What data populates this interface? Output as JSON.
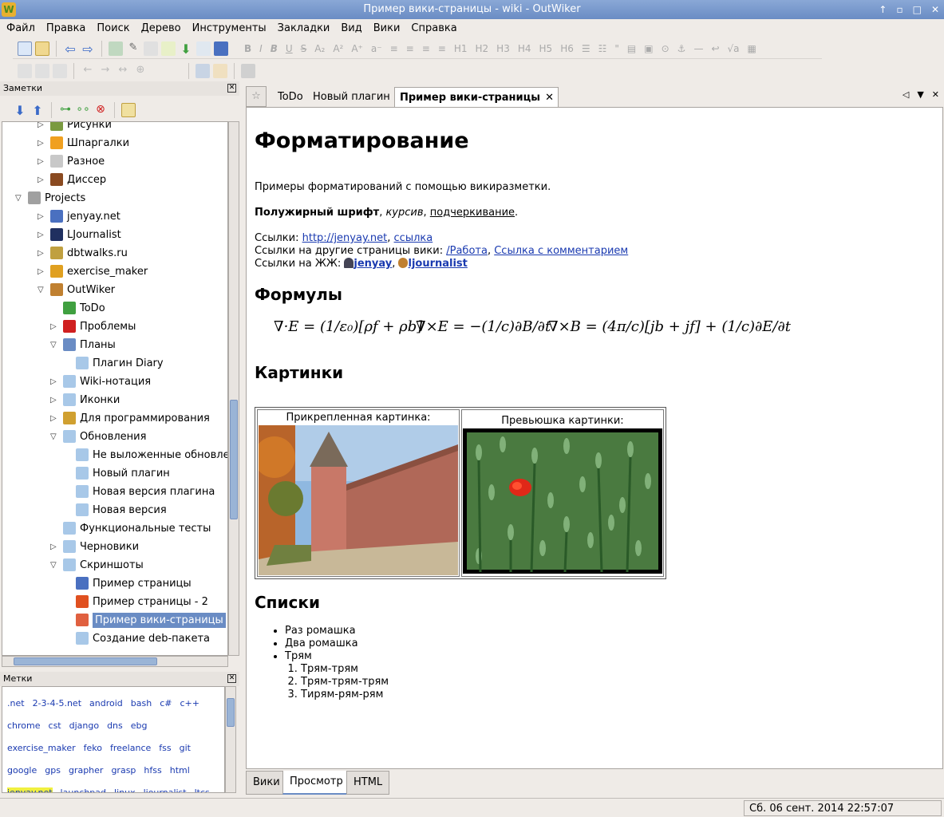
{
  "window": {
    "title": "Пример вики-страницы - wiki - OutWiker",
    "logo": "W",
    "min": "↑",
    "restore": "▫",
    "max": "□",
    "close": "✕"
  },
  "menu": [
    "Файл",
    "Правка",
    "Поиск",
    "Дерево",
    "Инструменты",
    "Закладки",
    "Вид",
    "Вики",
    "Справка"
  ],
  "notes_panel": {
    "title": "Заметки",
    "close": "✕"
  },
  "tree": [
    {
      "label": "Рисунки",
      "level": 2,
      "arrow": "▷",
      "icon": "image-icon",
      "color": "#7a9a40"
    },
    {
      "label": "Шпаргалки",
      "level": 2,
      "arrow": "▷",
      "icon": "star-icon",
      "color": "#f0a020"
    },
    {
      "label": "Разное",
      "level": 2,
      "arrow": "▷",
      "icon": "jar-icon",
      "color": "#c8c8c8"
    },
    {
      "label": "Диссер",
      "level": 2,
      "arrow": "▷",
      "icon": "book-icon",
      "color": "#8a4a20"
    },
    {
      "label": "Projects",
      "level": 1,
      "arrow": "▽",
      "icon": "bank-icon",
      "color": "#a0a0a0"
    },
    {
      "label": "jenyay.net",
      "level": 2,
      "arrow": "▷",
      "icon": "brush-icon",
      "color": "#4a70c0"
    },
    {
      "label": "LJournalist",
      "level": 2,
      "arrow": "▷",
      "icon": "pen-icon",
      "color": "#203060"
    },
    {
      "label": "dbtwalks.ru",
      "level": 2,
      "arrow": "▷",
      "icon": "picture-icon",
      "color": "#c0a040"
    },
    {
      "label": "exercise_maker",
      "level": 2,
      "arrow": "▷",
      "icon": "horn-icon",
      "color": "#e0a020"
    },
    {
      "label": "OutWiker",
      "level": 2,
      "arrow": "▽",
      "icon": "owl-icon",
      "color": "#c08030"
    },
    {
      "label": "ToDo",
      "level": 3,
      "arrow": "",
      "icon": "check-icon",
      "color": "#40a040"
    },
    {
      "label": "Проблемы",
      "level": 3,
      "arrow": "▷",
      "icon": "error-icon",
      "color": "#d02020"
    },
    {
      "label": "Планы",
      "level": 3,
      "arrow": "▽",
      "icon": "plan-icon",
      "color": "#6a8cc4"
    },
    {
      "label": "Плагин Diary",
      "level": 4,
      "arrow": "",
      "icon": "page-icon",
      "color": "#a8c8e8"
    },
    {
      "label": "Wiki-нотация",
      "level": 3,
      "arrow": "▷",
      "icon": "page-icon",
      "color": "#a8c8e8"
    },
    {
      "label": "Иконки",
      "level": 3,
      "arrow": "▷",
      "icon": "page-icon",
      "color": "#a8c8e8"
    },
    {
      "label": "Для программирования",
      "level": 3,
      "arrow": "▷",
      "icon": "wand-icon",
      "color": "#d0a030"
    },
    {
      "label": "Обновления",
      "level": 3,
      "arrow": "▽",
      "icon": "page-icon",
      "color": "#a8c8e8"
    },
    {
      "label": "Не выложенные обновлен",
      "level": 4,
      "arrow": "",
      "icon": "page-icon",
      "color": "#a8c8e8"
    },
    {
      "label": "Новый плагин",
      "level": 4,
      "arrow": "",
      "icon": "page-icon",
      "color": "#a8c8e8"
    },
    {
      "label": "Новая версия плагина",
      "level": 4,
      "arrow": "",
      "icon": "page-icon",
      "color": "#a8c8e8"
    },
    {
      "label": "Новая версия",
      "level": 4,
      "arrow": "",
      "icon": "page-icon",
      "color": "#a8c8e8"
    },
    {
      "label": "Функциональные тесты",
      "level": 3,
      "arrow": "",
      "icon": "page-icon",
      "color": "#a8c8e8"
    },
    {
      "label": "Черновики",
      "level": 3,
      "arrow": "▷",
      "icon": "page-icon",
      "color": "#a8c8e8"
    },
    {
      "label": "Скриншоты",
      "level": 3,
      "arrow": "▽",
      "icon": "page-icon",
      "color": "#a8c8e8"
    },
    {
      "label": "Пример страницы",
      "level": 4,
      "arrow": "",
      "icon": "user-icon",
      "color": "#4a70c0"
    },
    {
      "label": "Пример страницы - 2",
      "level": 4,
      "arrow": "",
      "icon": "cone-icon",
      "color": "#e05020"
    },
    {
      "label": "Пример вики-страницы",
      "level": 4,
      "arrow": "",
      "icon": "flag-icon",
      "color": "#e06040",
      "selected": true
    },
    {
      "label": "Создание deb-пакета",
      "level": 4,
      "arrow": "",
      "icon": "page-icon",
      "color": "#a8c8e8"
    }
  ],
  "tags_panel": {
    "title": "Метки",
    "close": "✕"
  },
  "tags": [
    [
      ".net",
      "2-3-4-5.net",
      "android",
      "bash",
      "c#",
      "c++"
    ],
    [
      "chrome",
      "cst",
      "django",
      "dns",
      "ebg"
    ],
    [
      "exercise_maker",
      "feko",
      "freelance",
      "fss",
      "git"
    ],
    [
      "google",
      "gps",
      "grapher",
      "grasp",
      "hfss",
      "html"
    ],
    [
      "jenyay.net",
      "launchpad",
      "linux",
      "ljournalist",
      "ltcs"
    ]
  ],
  "tabs": [
    {
      "label": "ToDo",
      "active": false
    },
    {
      "label": "Новый плагин",
      "active": false
    },
    {
      "label": "Пример вики-страницы",
      "active": true
    }
  ],
  "tab_close": "✕",
  "tab_nav": {
    "prev": "◁",
    "menu": "▼",
    "close": "✕"
  },
  "page": {
    "h_format": "Форматирование",
    "intro": "Примеры форматирований с помощью викиразметки.",
    "bold": "Полужирный шрифт",
    "italic": "курсив",
    "underline": "подчеркивание",
    "links_label": "Ссылки:",
    "link1": "http://jenyay.net",
    "link2": "ссылка",
    "wiki_links_label": "Ссылки на другие страницы вики:",
    "wlink1": "/Работа",
    "wlink2": "Ссылка с комментарием",
    "lj_label": "Ссылки на ЖЖ:",
    "lj1": "jenyay",
    "lj2": "ljournalist",
    "h_formulas": "Формулы",
    "f1": "∇·E = (1/ε₀)[ρf + ρb]",
    "f2": "∇×E = −(1/c)∂B/∂t",
    "f3": "∇×B = (4π/c)[jb + jf] + (1/c)∂E/∂t",
    "h_pictures": "Картинки",
    "pic1_caption": "Прикрепленная картинка:",
    "pic2_caption": "Превьюшка картинки:",
    "h_lists": "Списки",
    "ul": [
      "Раз ромашка",
      "Два ромашка",
      "Трям"
    ],
    "ol": [
      "Трям-трям",
      "Трям-трям-трям",
      "Тирям-рям-рям"
    ]
  },
  "bottom_tabs": [
    "Вики",
    "Просмотр",
    "HTML"
  ],
  "status": {
    "clock": "Сб. 06 сент. 2014 22:57:07"
  }
}
